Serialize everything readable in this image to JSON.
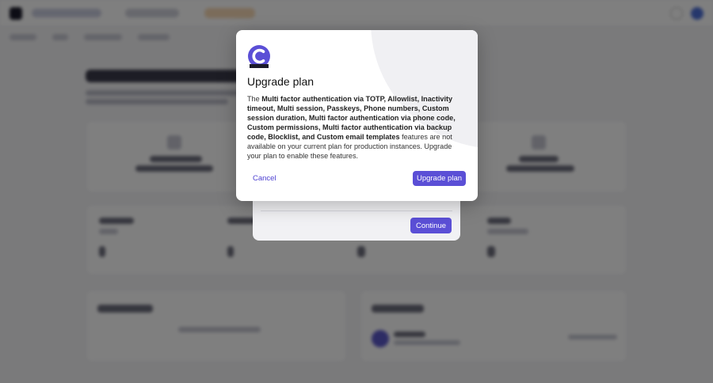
{
  "colors": {
    "accent": "#5b4fd6",
    "overlay": "rgba(0,0,0,0.5)",
    "modal_bg": "#ffffff"
  },
  "upgrade_modal": {
    "icon": "logto-logo-icon",
    "title": "Upgrade plan",
    "body": {
      "prefix": "The",
      "features": "Multi factor authentication via TOTP, Allowlist, Inactivity timeout, Multi session, Passkeys, Phone numbers, Custom session duration, Multi factor authentication via phone code, Custom permissions, Multi factor authentication via backup code, Blocklist, and Custom email templates",
      "suffix": "features are not available on your current plan for production instances. Upgrade your plan to enable these features."
    },
    "cancel_label": "Cancel",
    "upgrade_label": "Upgrade plan"
  },
  "underlying_dialog": {
    "continue_label": "Continue"
  }
}
